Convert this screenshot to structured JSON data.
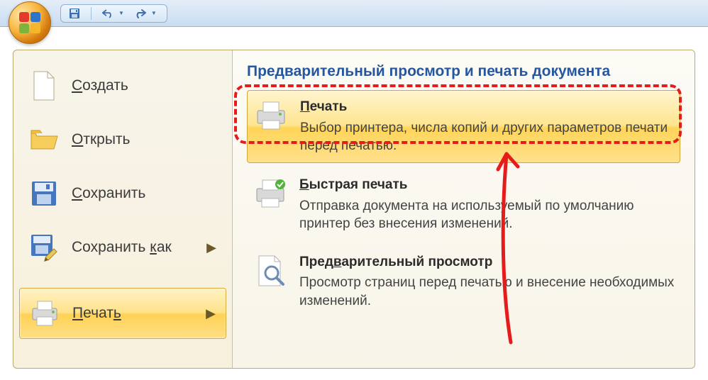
{
  "qat": {
    "save": "save-icon",
    "undo": "undo-icon",
    "redo": "redo-icon"
  },
  "menu": {
    "new_label": "Создать",
    "open_label": "Открыть",
    "save_label": "Сохранить",
    "saveas_label_pre": "Сохранить ",
    "saveas_label_u": "к",
    "saveas_label_post": "ак",
    "print_label": "Печать",
    "print_u": "ь"
  },
  "pane": {
    "title": "Предварительный просмотр и печать документа",
    "opt1": {
      "title_u": "П",
      "title_rest": "ечать",
      "desc": "Выбор принтера, числа копий и других параметров печати перед печатью."
    },
    "opt2": {
      "title_u": "Б",
      "title_rest": "ыстрая печать",
      "desc": "Отправка документа на используемый по умолчанию принтер без внесения изменений."
    },
    "opt3": {
      "title_pre": "Пред",
      "title_u": "в",
      "title_post": "арительный просмотр",
      "desc": "Просмотр страниц перед печатью и внесение необходимых изменений."
    }
  }
}
